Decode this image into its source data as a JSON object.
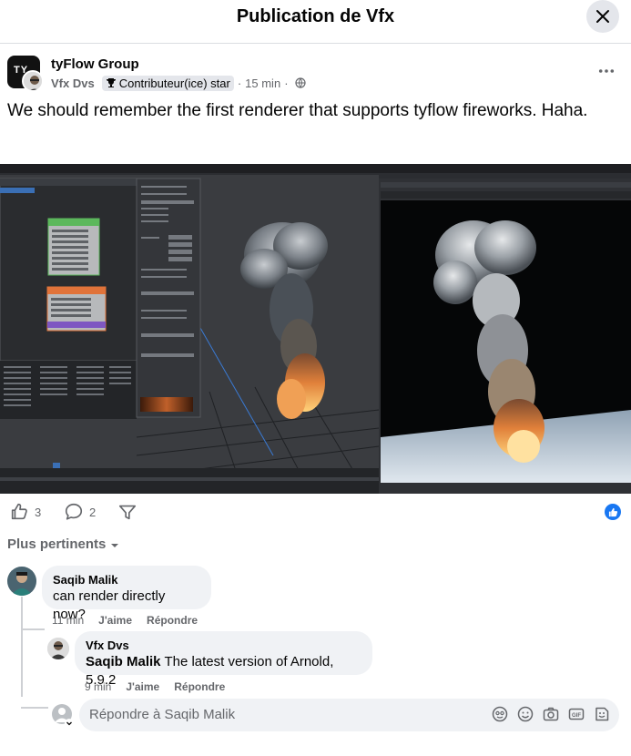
{
  "header": {
    "title": "Publication de Vfx"
  },
  "post": {
    "group_name": "tyFlow Group",
    "page_logo": "TY",
    "author": "Vfx Dvs",
    "badge": "Contributeur(ice) star",
    "separator": "·",
    "time": "15 min",
    "text": "We should remember the first renderer that supports tyflow fireworks. Haha."
  },
  "reactions": {
    "likes": "3",
    "comments": "2"
  },
  "sort_label": "Plus pertinents",
  "comments": [
    {
      "author": "Saqib Malik",
      "text": "can render directly now?",
      "time": "11 min",
      "like_label": "J'aime",
      "reply_label": "Répondre"
    },
    {
      "author": "Vfx Dvs",
      "mention": "Saqib Malik",
      "text": "The latest version of Arnold, 5.9.2",
      "time": "9 min",
      "like_label": "J'aime",
      "reply_label": "Répondre"
    }
  ],
  "reply_box": {
    "placeholder": "Répondre à Saqib Malik"
  },
  "icons": [
    "close-icon",
    "more-icon",
    "trophy-icon",
    "globe-icon",
    "like-icon",
    "comment-icon",
    "share-icon",
    "chevron-down-icon",
    "emoji-icon",
    "camera-icon",
    "gif-icon",
    "sticker-icon"
  ],
  "colors": {
    "accent": "#1877f2",
    "bubble": "#f0f2f5",
    "secondary_text": "#65676b"
  }
}
